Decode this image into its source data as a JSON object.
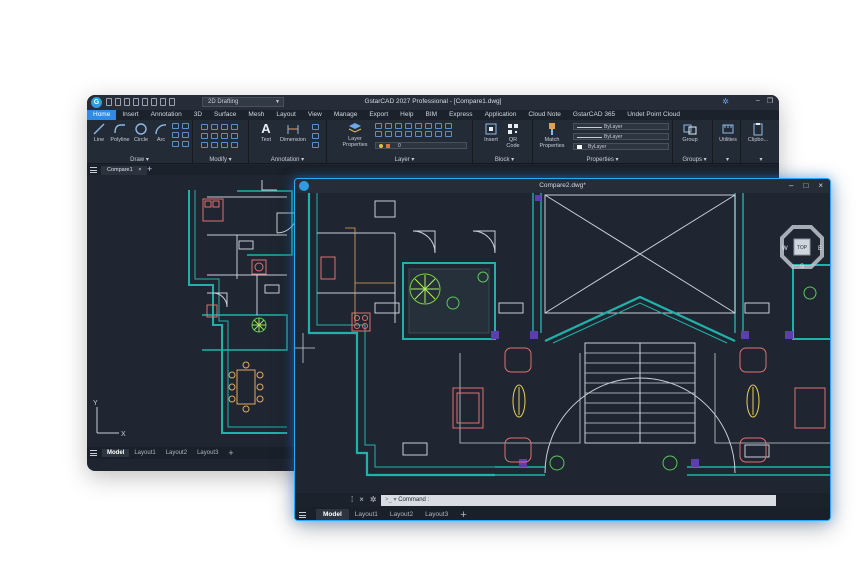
{
  "back_window": {
    "workspace": "2D Drafting",
    "title": "GstarCAD 2027 Professional - [Compare1.dwg]",
    "menu": [
      "Home",
      "Insert",
      "Annotation",
      "3D",
      "Surface",
      "Mesh",
      "Layout",
      "View",
      "Manage",
      "Export",
      "Help",
      "BIM",
      "Express",
      "Application",
      "Cloud Note",
      "GstarCAD 365",
      "Undet Point Cloud"
    ],
    "ribbon": {
      "draw": {
        "label": "Draw",
        "tools": [
          "Line",
          "Polyline",
          "Circle",
          "Arc"
        ]
      },
      "modify": {
        "label": "Modify"
      },
      "annotation": {
        "label": "Annotation",
        "tools": [
          "Text",
          "Dimension"
        ]
      },
      "layer": {
        "label": "Layer",
        "tools": [
          "Layer Properties"
        ],
        "current": "0"
      },
      "block": {
        "label": "Block",
        "tools": [
          "Insert",
          "QR Code"
        ]
      },
      "properties": {
        "label": "Properties",
        "tools": [
          "Match Properties"
        ],
        "rows": [
          "ByLayer",
          "ByLayer",
          "ByLayer"
        ]
      },
      "groups": {
        "label": "Groups",
        "tools": [
          "Group"
        ]
      },
      "utilities": {
        "tools": [
          "Utilities"
        ]
      },
      "clipboard": {
        "tools": [
          "Clipbo..."
        ]
      }
    },
    "doc_tab": "Compare1",
    "layout_tabs": [
      "Model",
      "Layout1",
      "Layout2",
      "Layout3"
    ]
  },
  "front_window": {
    "title": "Compare2.dwg*",
    "command_prompt": "Command :",
    "layout_tabs": [
      "Model",
      "Layout1",
      "Layout2",
      "Layout3"
    ],
    "viewcube": {
      "top": "TOP",
      "west": "W",
      "east": "E",
      "south": "S"
    }
  },
  "colors": {
    "accent": "#2f8be6",
    "wall_teal": "#20b2aa",
    "furniture_red": "#e27070",
    "plant_green": "#5ac85a",
    "drawing_white": "#d0d6de",
    "beam_purple": "#5b3fb0"
  }
}
